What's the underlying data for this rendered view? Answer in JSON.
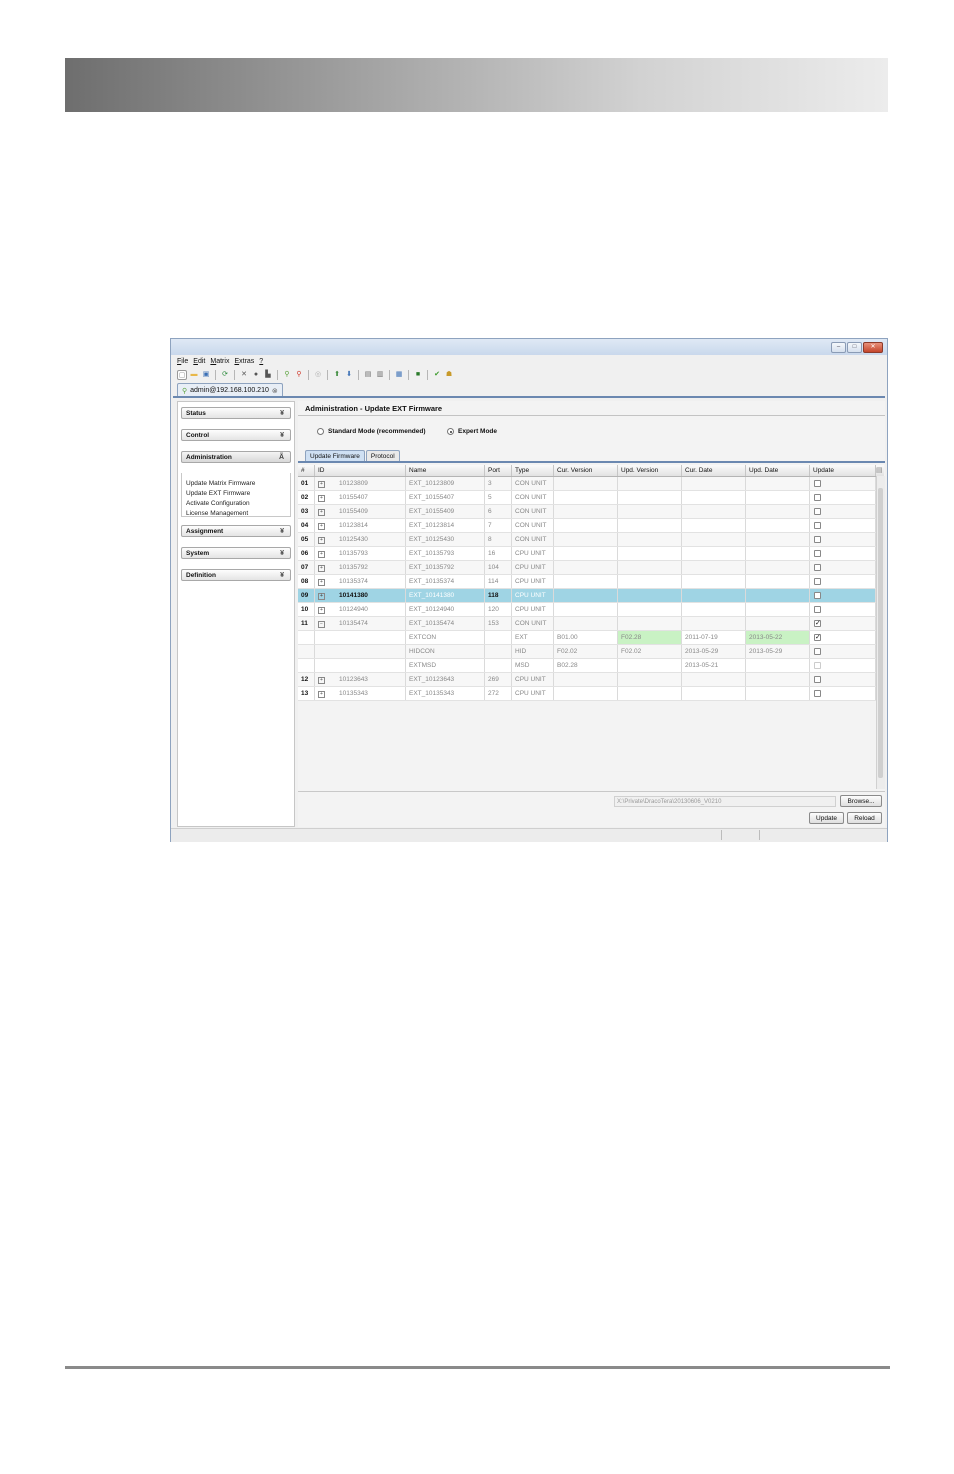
{
  "window": {
    "controls": [
      "–",
      "□",
      "✕"
    ],
    "menus": [
      {
        "first": "F",
        "rest": "ile"
      },
      {
        "first": "E",
        "rest": "dit"
      },
      {
        "first": "M",
        "rest": "atrix"
      },
      {
        "first": "E",
        "rest": "xtras"
      },
      {
        "first": "?",
        "rest": ""
      }
    ],
    "toolbar_icons": [
      {
        "name": "new-icon",
        "glyph": "▢",
        "color": "#ffffff"
      },
      {
        "name": "open-icon",
        "glyph": "▬",
        "color": "#e8b84a"
      },
      {
        "name": "save-icon",
        "glyph": "▣",
        "color": "#3a6fb5"
      },
      {
        "name": "sep"
      },
      {
        "name": "refresh-icon",
        "glyph": "⟳",
        "color": "#2a8a3a"
      },
      {
        "name": "sep"
      },
      {
        "name": "cut-icon",
        "glyph": "✕",
        "color": "#555555"
      },
      {
        "name": "record-icon",
        "glyph": "●",
        "color": "#555555"
      },
      {
        "name": "paste-icon",
        "glyph": "▙",
        "color": "#555555"
      },
      {
        "name": "sep"
      },
      {
        "name": "connect-icon",
        "glyph": "⚲",
        "color": "#5aa33c"
      },
      {
        "name": "disconnect-icon",
        "glyph": "⚲",
        "color": "#d0382a"
      },
      {
        "name": "sep"
      },
      {
        "name": "settings-icon",
        "glyph": "◎",
        "color": "#b0b0b0"
      },
      {
        "name": "sep"
      },
      {
        "name": "upload-icon",
        "glyph": "⬆",
        "color": "#3a8a3a"
      },
      {
        "name": "download-icon",
        "glyph": "⬇",
        "color": "#3a6fb5"
      },
      {
        "name": "sep"
      },
      {
        "name": "document-icon",
        "glyph": "▤",
        "color": "#666666"
      },
      {
        "name": "export-icon",
        "glyph": "▥",
        "color": "#666666"
      },
      {
        "name": "sep"
      },
      {
        "name": "report-icon",
        "glyph": "▦",
        "color": "#3a6fb5"
      },
      {
        "name": "sep"
      },
      {
        "name": "monitor-icon",
        "glyph": "■",
        "color": "#2a7a2a"
      },
      {
        "name": "sep"
      },
      {
        "name": "check-icon",
        "glyph": "✔",
        "color": "#3a9a2a"
      },
      {
        "name": "user-icon",
        "glyph": "☗",
        "color": "#c89a2a"
      }
    ],
    "connection_tab": "admin@192.168.100.210"
  },
  "sidebar": {
    "sections": [
      {
        "label": "Status",
        "chevron": "¥"
      },
      {
        "label": "Control",
        "chevron": "¥"
      },
      {
        "label": "Administration",
        "chevron": "Ã"
      },
      {
        "label": "Assignment",
        "chevron": "¥"
      },
      {
        "label": "System",
        "chevron": "¥"
      },
      {
        "label": "Definition",
        "chevron": "¥"
      }
    ],
    "admin_links": [
      "Update Matrix Firmware",
      "Update EXT Firmware",
      "Activate Configuration",
      "License Management"
    ]
  },
  "content": {
    "title": "Administration - Update EXT Firmware",
    "mode_standard": "Standard Mode (recommended)",
    "mode_expert": "Expert Mode",
    "selected_mode": "expert",
    "tabs": [
      "Update Firmware",
      "Protocol"
    ],
    "active_tab": 0
  },
  "table": {
    "columns": [
      "#",
      "ID",
      "Name",
      "Port",
      "Type",
      "Cur. Version",
      "Upd. Version",
      "Cur. Date",
      "Upd. Date",
      "Update"
    ],
    "rows": [
      {
        "num": "01",
        "exp": "+",
        "id": "10123809",
        "name": "EXT_10123809",
        "port": "3",
        "type": "CON UNIT",
        "cur_ver": "",
        "upd_ver": "",
        "cur_date": "",
        "upd_date": "",
        "checked": false
      },
      {
        "num": "02",
        "exp": "+",
        "id": "10155407",
        "name": "EXT_10155407",
        "port": "5",
        "type": "CON UNIT",
        "cur_ver": "",
        "upd_ver": "",
        "cur_date": "",
        "upd_date": "",
        "checked": false
      },
      {
        "num": "03",
        "exp": "+",
        "id": "10155409",
        "name": "EXT_10155409",
        "port": "6",
        "type": "CON UNIT",
        "cur_ver": "",
        "upd_ver": "",
        "cur_date": "",
        "upd_date": "",
        "checked": false
      },
      {
        "num": "04",
        "exp": "+",
        "id": "10123814",
        "name": "EXT_10123814",
        "port": "7",
        "type": "CON UNIT",
        "cur_ver": "",
        "upd_ver": "",
        "cur_date": "",
        "upd_date": "",
        "checked": false
      },
      {
        "num": "05",
        "exp": "+",
        "id": "10125430",
        "name": "EXT_10125430",
        "port": "8",
        "type": "CON UNIT",
        "cur_ver": "",
        "upd_ver": "",
        "cur_date": "",
        "upd_date": "",
        "checked": false
      },
      {
        "num": "06",
        "exp": "+",
        "id": "10135793",
        "name": "EXT_10135793",
        "port": "16",
        "type": "CPU UNIT",
        "cur_ver": "",
        "upd_ver": "",
        "cur_date": "",
        "upd_date": "",
        "checked": false
      },
      {
        "num": "07",
        "exp": "+",
        "id": "10135792",
        "name": "EXT_10135792",
        "port": "104",
        "type": "CPU UNIT",
        "cur_ver": "",
        "upd_ver": "",
        "cur_date": "",
        "upd_date": "",
        "checked": false
      },
      {
        "num": "08",
        "exp": "+",
        "id": "10135374",
        "name": "EXT_10135374",
        "port": "114",
        "type": "CPU UNIT",
        "cur_ver": "",
        "upd_ver": "",
        "cur_date": "",
        "upd_date": "",
        "checked": false
      },
      {
        "num": "09",
        "exp": "+",
        "id": "10141380",
        "name": "EXT_10141380",
        "port": "118",
        "type": "CPU UNIT",
        "cur_ver": "",
        "upd_ver": "",
        "cur_date": "",
        "upd_date": "",
        "checked": false,
        "selected": true
      },
      {
        "num": "10",
        "exp": "+",
        "id": "10124940",
        "name": "EXT_10124940",
        "port": "120",
        "type": "CPU UNIT",
        "cur_ver": "",
        "upd_ver": "",
        "cur_date": "",
        "upd_date": "",
        "checked": false
      },
      {
        "num": "11",
        "exp": "−",
        "id": "10135474",
        "name": "EXT_10135474",
        "port": "153",
        "type": "CON UNIT",
        "cur_ver": "",
        "upd_ver": "",
        "cur_date": "",
        "upd_date": "",
        "checked": true
      },
      {
        "num": "",
        "exp": "",
        "id": "",
        "name": "EXTCON",
        "port": "",
        "type": "EXT",
        "cur_ver": "B01.00",
        "upd_ver": "F02.28",
        "cur_date": "2011-07-19",
        "upd_date": "2013-05-22",
        "checked": true,
        "green": true,
        "child": true
      },
      {
        "num": "",
        "exp": "",
        "id": "",
        "name": "HIDCON",
        "port": "",
        "type": "HID",
        "cur_ver": "F02.02",
        "upd_ver": "F02.02",
        "cur_date": "2013-05-29",
        "upd_date": "2013-05-29",
        "checked": false,
        "child": true
      },
      {
        "num": "",
        "exp": "",
        "id": "",
        "name": "EXTMSD",
        "port": "",
        "type": "MSD",
        "cur_ver": "B02.28",
        "upd_ver": "",
        "cur_date": "2013-05-21",
        "upd_date": "",
        "checked": false,
        "disabled": true,
        "child": true
      },
      {
        "num": "12",
        "exp": "+",
        "id": "10123643",
        "name": "EXT_10123643",
        "port": "269",
        "type": "CPU UNIT",
        "cur_ver": "",
        "upd_ver": "",
        "cur_date": "",
        "upd_date": "",
        "checked": false
      },
      {
        "num": "13",
        "exp": "+",
        "id": "10135343",
        "name": "EXT_10135343",
        "port": "272",
        "type": "CPU UNIT",
        "cur_ver": "",
        "upd_ver": "",
        "cur_date": "",
        "upd_date": "",
        "checked": false
      }
    ]
  },
  "footer": {
    "path": "X:\\Private\\DracoTera\\20130606_V0210",
    "browse_label": "Browse...",
    "update_label": "Update",
    "reload_label": "Reload"
  }
}
